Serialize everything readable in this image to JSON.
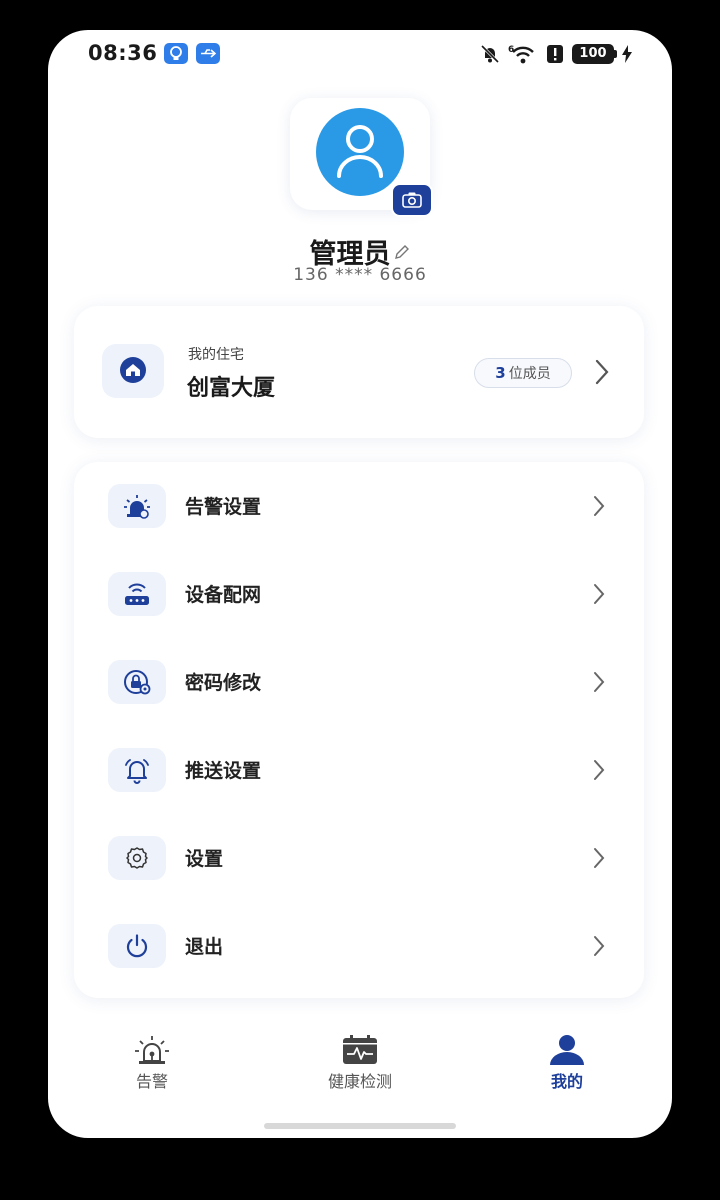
{
  "status_bar": {
    "time": "08:36",
    "battery_level": "100",
    "icons": [
      "lightbulb-icon",
      "usb-icon",
      "mute-icon",
      "wifi-6-icon",
      "alert-icon",
      "battery-icon",
      "charging-icon"
    ]
  },
  "profile": {
    "username": "管理员",
    "phone": "136 **** 6666",
    "icons": [
      "avatar-icon",
      "camera-icon",
      "edit-pencil-icon"
    ]
  },
  "residence": {
    "label": "我的住宅",
    "name": "创富大厦",
    "member_count": "3",
    "member_suffix": "位成员",
    "icon": "home-icon"
  },
  "menu": {
    "items": [
      {
        "label": "告警设置",
        "icon": "alarm-light-icon"
      },
      {
        "label": "设备配网",
        "icon": "router-icon"
      },
      {
        "label": "密码修改",
        "icon": "lock-gear-icon"
      },
      {
        "label": "推送设置",
        "icon": "bell-icon"
      },
      {
        "label": "设置",
        "icon": "gear-icon"
      },
      {
        "label": "退出",
        "icon": "power-icon"
      }
    ]
  },
  "nav": {
    "items": [
      {
        "label": "告警",
        "icon": "alarm-light-icon",
        "active": false
      },
      {
        "label": "健康检测",
        "icon": "health-calendar-icon",
        "active": false
      },
      {
        "label": "我的",
        "icon": "person-icon",
        "active": true
      }
    ]
  },
  "colors": {
    "accent": "#1e3f9a",
    "avatar_bg": "#2a9ae6",
    "icon_tile_bg": "#eef2fa",
    "page_bg": "#ffffff",
    "frame_bg": "#000000"
  }
}
